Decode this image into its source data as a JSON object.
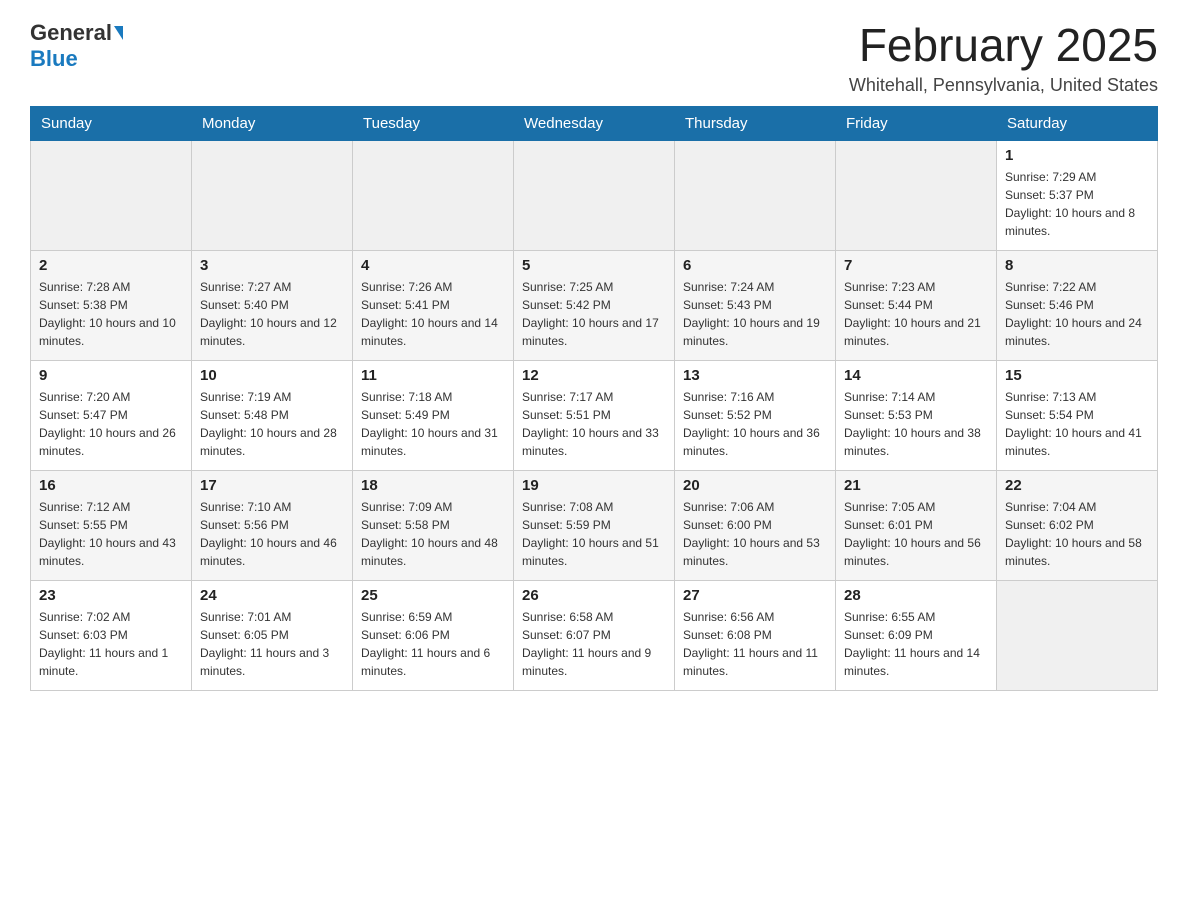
{
  "header": {
    "logo_general": "General",
    "logo_blue": "Blue",
    "month_title": "February 2025",
    "location": "Whitehall, Pennsylvania, United States"
  },
  "days_of_week": [
    "Sunday",
    "Monday",
    "Tuesday",
    "Wednesday",
    "Thursday",
    "Friday",
    "Saturday"
  ],
  "weeks": [
    [
      {
        "day": "",
        "empty": true
      },
      {
        "day": "",
        "empty": true
      },
      {
        "day": "",
        "empty": true
      },
      {
        "day": "",
        "empty": true
      },
      {
        "day": "",
        "empty": true
      },
      {
        "day": "",
        "empty": true
      },
      {
        "day": "1",
        "sunrise": "Sunrise: 7:29 AM",
        "sunset": "Sunset: 5:37 PM",
        "daylight": "Daylight: 10 hours and 8 minutes."
      }
    ],
    [
      {
        "day": "2",
        "sunrise": "Sunrise: 7:28 AM",
        "sunset": "Sunset: 5:38 PM",
        "daylight": "Daylight: 10 hours and 10 minutes."
      },
      {
        "day": "3",
        "sunrise": "Sunrise: 7:27 AM",
        "sunset": "Sunset: 5:40 PM",
        "daylight": "Daylight: 10 hours and 12 minutes."
      },
      {
        "day": "4",
        "sunrise": "Sunrise: 7:26 AM",
        "sunset": "Sunset: 5:41 PM",
        "daylight": "Daylight: 10 hours and 14 minutes."
      },
      {
        "day": "5",
        "sunrise": "Sunrise: 7:25 AM",
        "sunset": "Sunset: 5:42 PM",
        "daylight": "Daylight: 10 hours and 17 minutes."
      },
      {
        "day": "6",
        "sunrise": "Sunrise: 7:24 AM",
        "sunset": "Sunset: 5:43 PM",
        "daylight": "Daylight: 10 hours and 19 minutes."
      },
      {
        "day": "7",
        "sunrise": "Sunrise: 7:23 AM",
        "sunset": "Sunset: 5:44 PM",
        "daylight": "Daylight: 10 hours and 21 minutes."
      },
      {
        "day": "8",
        "sunrise": "Sunrise: 7:22 AM",
        "sunset": "Sunset: 5:46 PM",
        "daylight": "Daylight: 10 hours and 24 minutes."
      }
    ],
    [
      {
        "day": "9",
        "sunrise": "Sunrise: 7:20 AM",
        "sunset": "Sunset: 5:47 PM",
        "daylight": "Daylight: 10 hours and 26 minutes."
      },
      {
        "day": "10",
        "sunrise": "Sunrise: 7:19 AM",
        "sunset": "Sunset: 5:48 PM",
        "daylight": "Daylight: 10 hours and 28 minutes."
      },
      {
        "day": "11",
        "sunrise": "Sunrise: 7:18 AM",
        "sunset": "Sunset: 5:49 PM",
        "daylight": "Daylight: 10 hours and 31 minutes."
      },
      {
        "day": "12",
        "sunrise": "Sunrise: 7:17 AM",
        "sunset": "Sunset: 5:51 PM",
        "daylight": "Daylight: 10 hours and 33 minutes."
      },
      {
        "day": "13",
        "sunrise": "Sunrise: 7:16 AM",
        "sunset": "Sunset: 5:52 PM",
        "daylight": "Daylight: 10 hours and 36 minutes."
      },
      {
        "day": "14",
        "sunrise": "Sunrise: 7:14 AM",
        "sunset": "Sunset: 5:53 PM",
        "daylight": "Daylight: 10 hours and 38 minutes."
      },
      {
        "day": "15",
        "sunrise": "Sunrise: 7:13 AM",
        "sunset": "Sunset: 5:54 PM",
        "daylight": "Daylight: 10 hours and 41 minutes."
      }
    ],
    [
      {
        "day": "16",
        "sunrise": "Sunrise: 7:12 AM",
        "sunset": "Sunset: 5:55 PM",
        "daylight": "Daylight: 10 hours and 43 minutes."
      },
      {
        "day": "17",
        "sunrise": "Sunrise: 7:10 AM",
        "sunset": "Sunset: 5:56 PM",
        "daylight": "Daylight: 10 hours and 46 minutes."
      },
      {
        "day": "18",
        "sunrise": "Sunrise: 7:09 AM",
        "sunset": "Sunset: 5:58 PM",
        "daylight": "Daylight: 10 hours and 48 minutes."
      },
      {
        "day": "19",
        "sunrise": "Sunrise: 7:08 AM",
        "sunset": "Sunset: 5:59 PM",
        "daylight": "Daylight: 10 hours and 51 minutes."
      },
      {
        "day": "20",
        "sunrise": "Sunrise: 7:06 AM",
        "sunset": "Sunset: 6:00 PM",
        "daylight": "Daylight: 10 hours and 53 minutes."
      },
      {
        "day": "21",
        "sunrise": "Sunrise: 7:05 AM",
        "sunset": "Sunset: 6:01 PM",
        "daylight": "Daylight: 10 hours and 56 minutes."
      },
      {
        "day": "22",
        "sunrise": "Sunrise: 7:04 AM",
        "sunset": "Sunset: 6:02 PM",
        "daylight": "Daylight: 10 hours and 58 minutes."
      }
    ],
    [
      {
        "day": "23",
        "sunrise": "Sunrise: 7:02 AM",
        "sunset": "Sunset: 6:03 PM",
        "daylight": "Daylight: 11 hours and 1 minute."
      },
      {
        "day": "24",
        "sunrise": "Sunrise: 7:01 AM",
        "sunset": "Sunset: 6:05 PM",
        "daylight": "Daylight: 11 hours and 3 minutes."
      },
      {
        "day": "25",
        "sunrise": "Sunrise: 6:59 AM",
        "sunset": "Sunset: 6:06 PM",
        "daylight": "Daylight: 11 hours and 6 minutes."
      },
      {
        "day": "26",
        "sunrise": "Sunrise: 6:58 AM",
        "sunset": "Sunset: 6:07 PM",
        "daylight": "Daylight: 11 hours and 9 minutes."
      },
      {
        "day": "27",
        "sunrise": "Sunrise: 6:56 AM",
        "sunset": "Sunset: 6:08 PM",
        "daylight": "Daylight: 11 hours and 11 minutes."
      },
      {
        "day": "28",
        "sunrise": "Sunrise: 6:55 AM",
        "sunset": "Sunset: 6:09 PM",
        "daylight": "Daylight: 11 hours and 14 minutes."
      },
      {
        "day": "",
        "empty": true
      }
    ]
  ]
}
